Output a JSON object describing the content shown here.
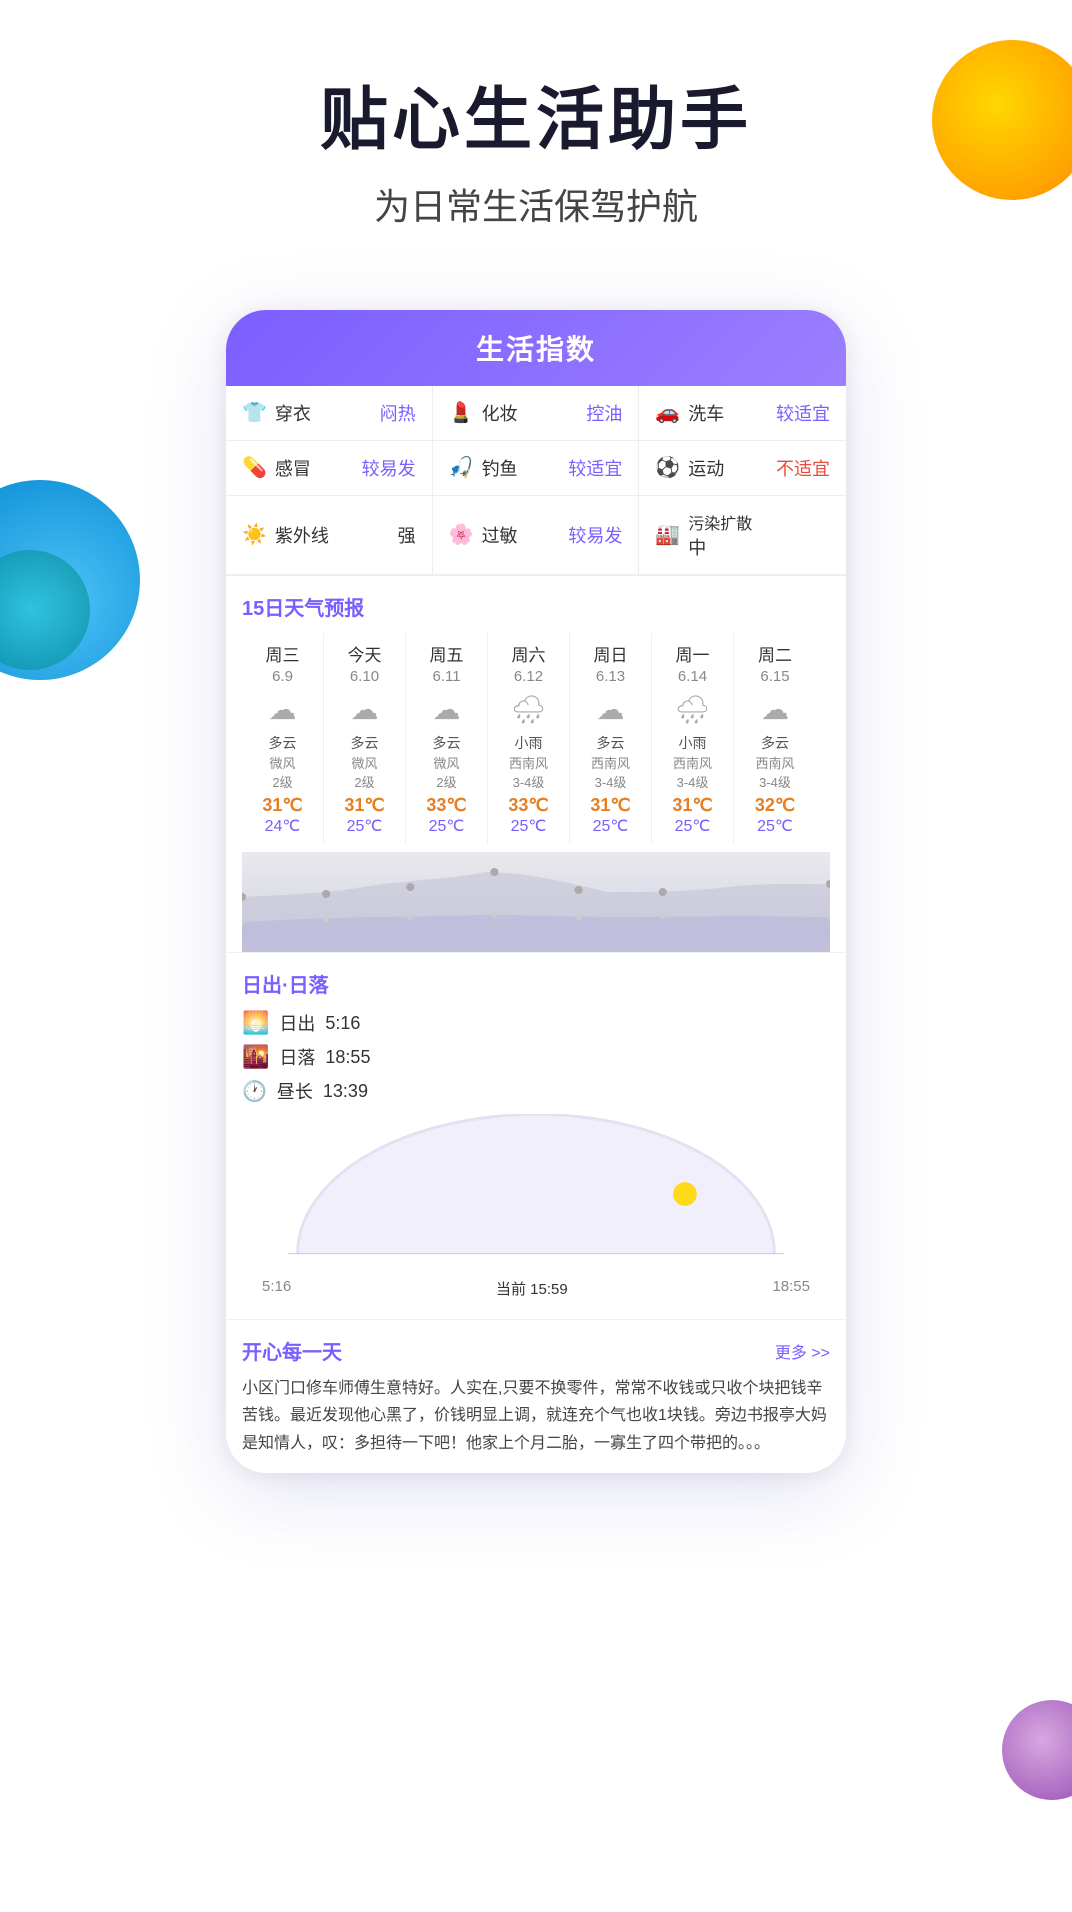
{
  "hero": {
    "title": "贴心生活助手",
    "subtitle": "为日常生活保驾护航"
  },
  "life_index": {
    "header": "生活指数",
    "cells": [
      {
        "icon": "👕",
        "label": "穿衣",
        "value": "闷热",
        "color": "normal"
      },
      {
        "icon": "💄",
        "label": "化妆",
        "value": "控油",
        "color": "purple"
      },
      {
        "icon": "🚗",
        "label": "洗车",
        "value": "较适宜",
        "color": "normal"
      },
      {
        "icon": "💊",
        "label": "感冒",
        "value": "较易发",
        "color": "purple"
      },
      {
        "icon": "🎣",
        "label": "钓鱼",
        "value": "较适宜",
        "color": "purple"
      },
      {
        "icon": "⚽",
        "label": "运动",
        "value": "不适宜",
        "color": "red"
      },
      {
        "icon": "☀️",
        "label": "紫外线",
        "value": "强",
        "color": "normal"
      },
      {
        "icon": "🌸",
        "label": "过敏",
        "value": "较易发",
        "color": "purple"
      },
      {
        "icon": "🏭",
        "label": "污染扩散",
        "value": "中",
        "color": "normal"
      }
    ]
  },
  "forecast": {
    "title": "15日天气预报",
    "days": [
      {
        "dow": "周三",
        "date": "6.9",
        "icon": "☁",
        "desc": "多云",
        "wind": "微风",
        "level": "2级",
        "high": "31℃",
        "low": "24℃"
      },
      {
        "dow": "今天",
        "date": "6.10",
        "icon": "☁",
        "desc": "多云",
        "wind": "微风",
        "level": "2级",
        "high": "31℃",
        "low": "25℃"
      },
      {
        "dow": "周五",
        "date": "6.11",
        "icon": "☁",
        "desc": "多云",
        "wind": "微风",
        "level": "2级",
        "high": "33℃",
        "low": "25℃"
      },
      {
        "dow": "周六",
        "date": "6.12",
        "icon": "🌧",
        "desc": "小雨",
        "wind": "西南风",
        "level": "3-4级",
        "high": "33℃",
        "low": "25℃"
      },
      {
        "dow": "周日",
        "date": "6.13",
        "icon": "☁",
        "desc": "多云",
        "wind": "西南风",
        "level": "3-4级",
        "high": "31℃",
        "low": "25℃"
      },
      {
        "dow": "周一",
        "date": "6.14",
        "icon": "🌧",
        "desc": "小雨",
        "wind": "西南风",
        "level": "3-4级",
        "high": "31℃",
        "low": "25℃"
      },
      {
        "dow": "周二",
        "date": "6.15",
        "icon": "☁",
        "desc": "多云",
        "wind": "西南风",
        "level": "3-4级",
        "high": "32℃",
        "low": "25℃"
      }
    ]
  },
  "sun": {
    "title": "日出·日落",
    "sunrise_label": "日出",
    "sunrise_value": "5:16",
    "sunset_label": "日落",
    "sunset_value": "18:55",
    "duration_label": "昼长",
    "duration_value": "13:39",
    "timeline": {
      "start": "5:16",
      "current": "当前 15:59",
      "end": "18:55"
    }
  },
  "happy": {
    "title": "开心每一天",
    "more": "更多 >>",
    "text": "小区门口修车师傅生意特好。人实在,只要不换零件，常常不收钱或只收个块把钱辛苦钱。最近发现他心黑了，价钱明显上调，就连充个气也收1块钱。旁边书报亭大妈是知情人，叹：多担待一下吧！他家上个月二胎，一寡生了四个带把的。。。"
  }
}
